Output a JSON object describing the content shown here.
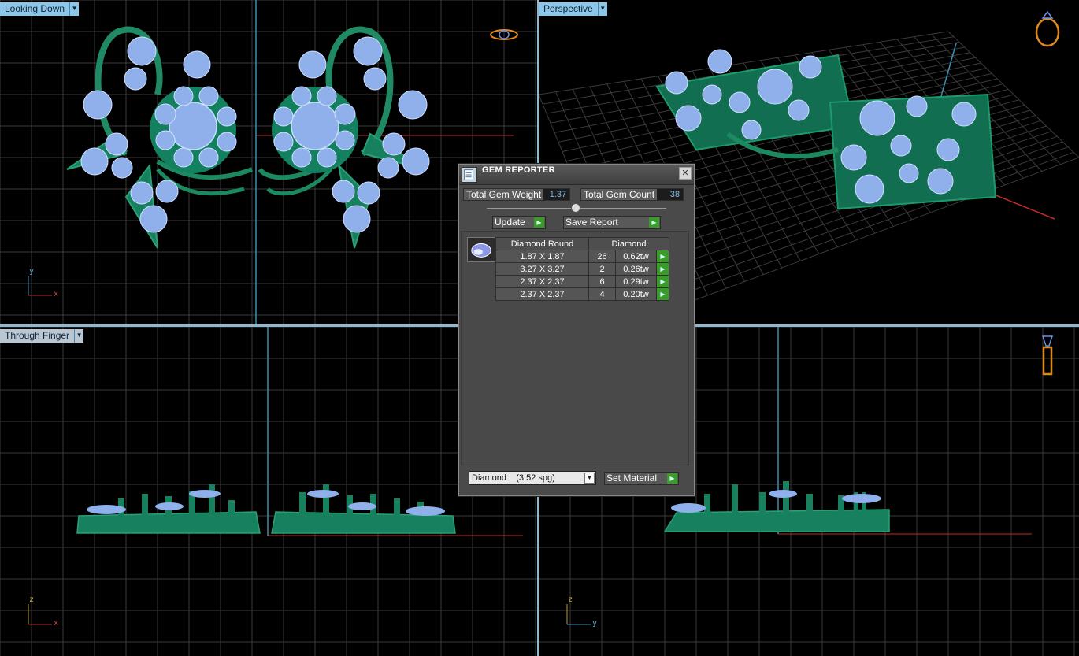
{
  "viewports": {
    "top_left": {
      "label": "Looking Down"
    },
    "top_right": {
      "label": "Perspective"
    },
    "bottom_left": {
      "label": "Through Finger"
    },
    "bottom_right": {
      "label": ""
    }
  },
  "axes": {
    "top_left": [
      "y",
      "x"
    ],
    "bottom_left": [
      "z",
      "x"
    ],
    "bottom_right": [
      "z",
      "y"
    ]
  },
  "colors": {
    "metal": "#17805e",
    "gem": "#8fb0ea",
    "grid": "#3b3b3b",
    "axis_red": "#c02a2a",
    "axis_blue": "#3e8fb0"
  },
  "icons": {
    "top_left": "ring-top-icon",
    "top_right": "ring-perspective-icon",
    "bottom_right": "ring-side-icon"
  },
  "dialog": {
    "title": "GEM REPORTER",
    "total_weight_label": "Total Gem Weight",
    "total_weight_value": "1.37",
    "total_count_label": "Total Gem Count",
    "total_count_value": "38",
    "update_label": "Update",
    "save_report_label": "Save Report",
    "table": {
      "headers": [
        "Diamond Round",
        "Diamond"
      ],
      "rows": [
        {
          "size": "1.87 X 1.87",
          "count": "26",
          "weight": "0.62tw"
        },
        {
          "size": "3.27 X 3.27",
          "count": "2",
          "weight": "0.26tw"
        },
        {
          "size": "2.37 X 2.37",
          "count": "6",
          "weight": "0.29tw"
        },
        {
          "size": "2.37 X 2.37",
          "count": "4",
          "weight": "0.20tw"
        }
      ]
    },
    "material_value": "Diamond    (3.52 spg)",
    "set_material_label": "Set Material"
  }
}
